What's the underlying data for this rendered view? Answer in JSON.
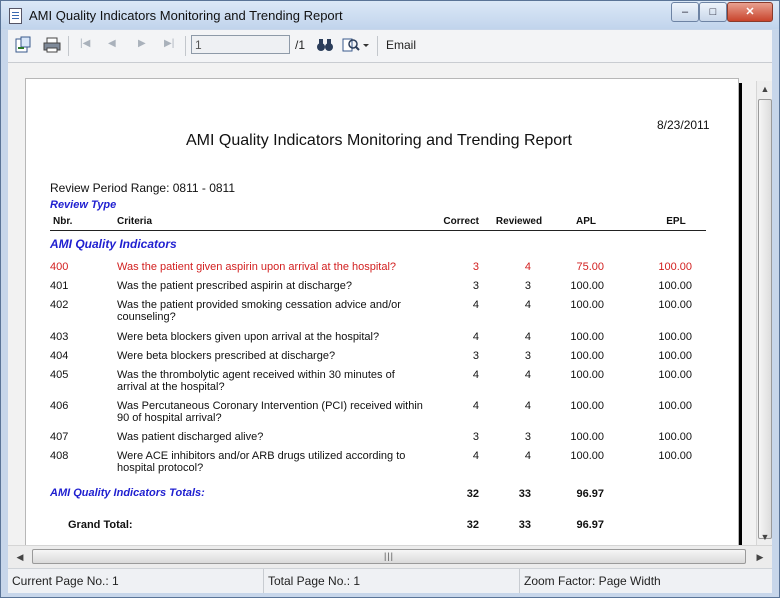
{
  "window": {
    "title": "AMI Quality Indicators Monitoring and Trending Report",
    "buttons": {
      "minimize": "–",
      "maximize": "□",
      "close": "✕"
    }
  },
  "toolbar": {
    "page_input_value": "1",
    "page_total": "/1",
    "email_label": "Email"
  },
  "report": {
    "date": "8/23/2011",
    "title": "AMI Quality Indicators Monitoring and Trending Report",
    "review_period": "Review Period Range: 0811 - 0811",
    "review_type_label": "Review Type",
    "columns": {
      "nbr": "Nbr.",
      "criteria": "Criteria",
      "correct": "Correct",
      "reviewed": "Reviewed",
      "apl": "APL",
      "epl": "EPL"
    },
    "section_title": "AMI Quality Indicators",
    "rows": [
      {
        "nbr": "400",
        "criteria": "Was the patient given aspirin upon arrival at the hospital?",
        "correct": "3",
        "reviewed": "4",
        "apl": "75.00",
        "epl": "100.00",
        "highlight": true
      },
      {
        "nbr": "401",
        "criteria": "Was the patient prescribed aspirin at discharge?",
        "correct": "3",
        "reviewed": "3",
        "apl": "100.00",
        "epl": "100.00"
      },
      {
        "nbr": "402",
        "criteria": "Was the patient provided smoking cessation advice and/or counseling?",
        "correct": "4",
        "reviewed": "4",
        "apl": "100.00",
        "epl": "100.00"
      },
      {
        "nbr": "403",
        "criteria": "Were beta blockers given upon arrival at the hospital?",
        "correct": "4",
        "reviewed": "4",
        "apl": "100.00",
        "epl": "100.00"
      },
      {
        "nbr": "404",
        "criteria": "Were beta blockers prescribed at discharge?",
        "correct": "3",
        "reviewed": "3",
        "apl": "100.00",
        "epl": "100.00"
      },
      {
        "nbr": "405",
        "criteria": "Was the thrombolytic agent received within 30 minutes of arrival at the hospital?",
        "correct": "4",
        "reviewed": "4",
        "apl": "100.00",
        "epl": "100.00"
      },
      {
        "nbr": "406",
        "criteria": "Was Percutaneous Coronary Intervention (PCI) received within 90 of hospital arrival?",
        "correct": "4",
        "reviewed": "4",
        "apl": "100.00",
        "epl": "100.00"
      },
      {
        "nbr": "407",
        "criteria": "Was patient discharged alive?",
        "correct": "3",
        "reviewed": "3",
        "apl": "100.00",
        "epl": "100.00"
      },
      {
        "nbr": "408",
        "criteria": "Were ACE inhibitors and/or ARB drugs utilized according to hospital protocol?",
        "correct": "4",
        "reviewed": "4",
        "apl": "100.00",
        "epl": "100.00"
      }
    ],
    "totals": {
      "label": "AMI Quality Indicators Totals:",
      "correct": "32",
      "reviewed": "33",
      "apl": "96.97"
    },
    "grand_total": {
      "label": "Grand Total:",
      "correct": "32",
      "reviewed": "33",
      "apl": "96.97"
    }
  },
  "status": {
    "current_page": "Current Page No.: 1",
    "total_page": "Total Page No.: 1",
    "zoom": "Zoom Factor: Page Width"
  },
  "colors": {
    "highlight_row": "#d21f1f",
    "section_blue": "#1f1fd0"
  }
}
